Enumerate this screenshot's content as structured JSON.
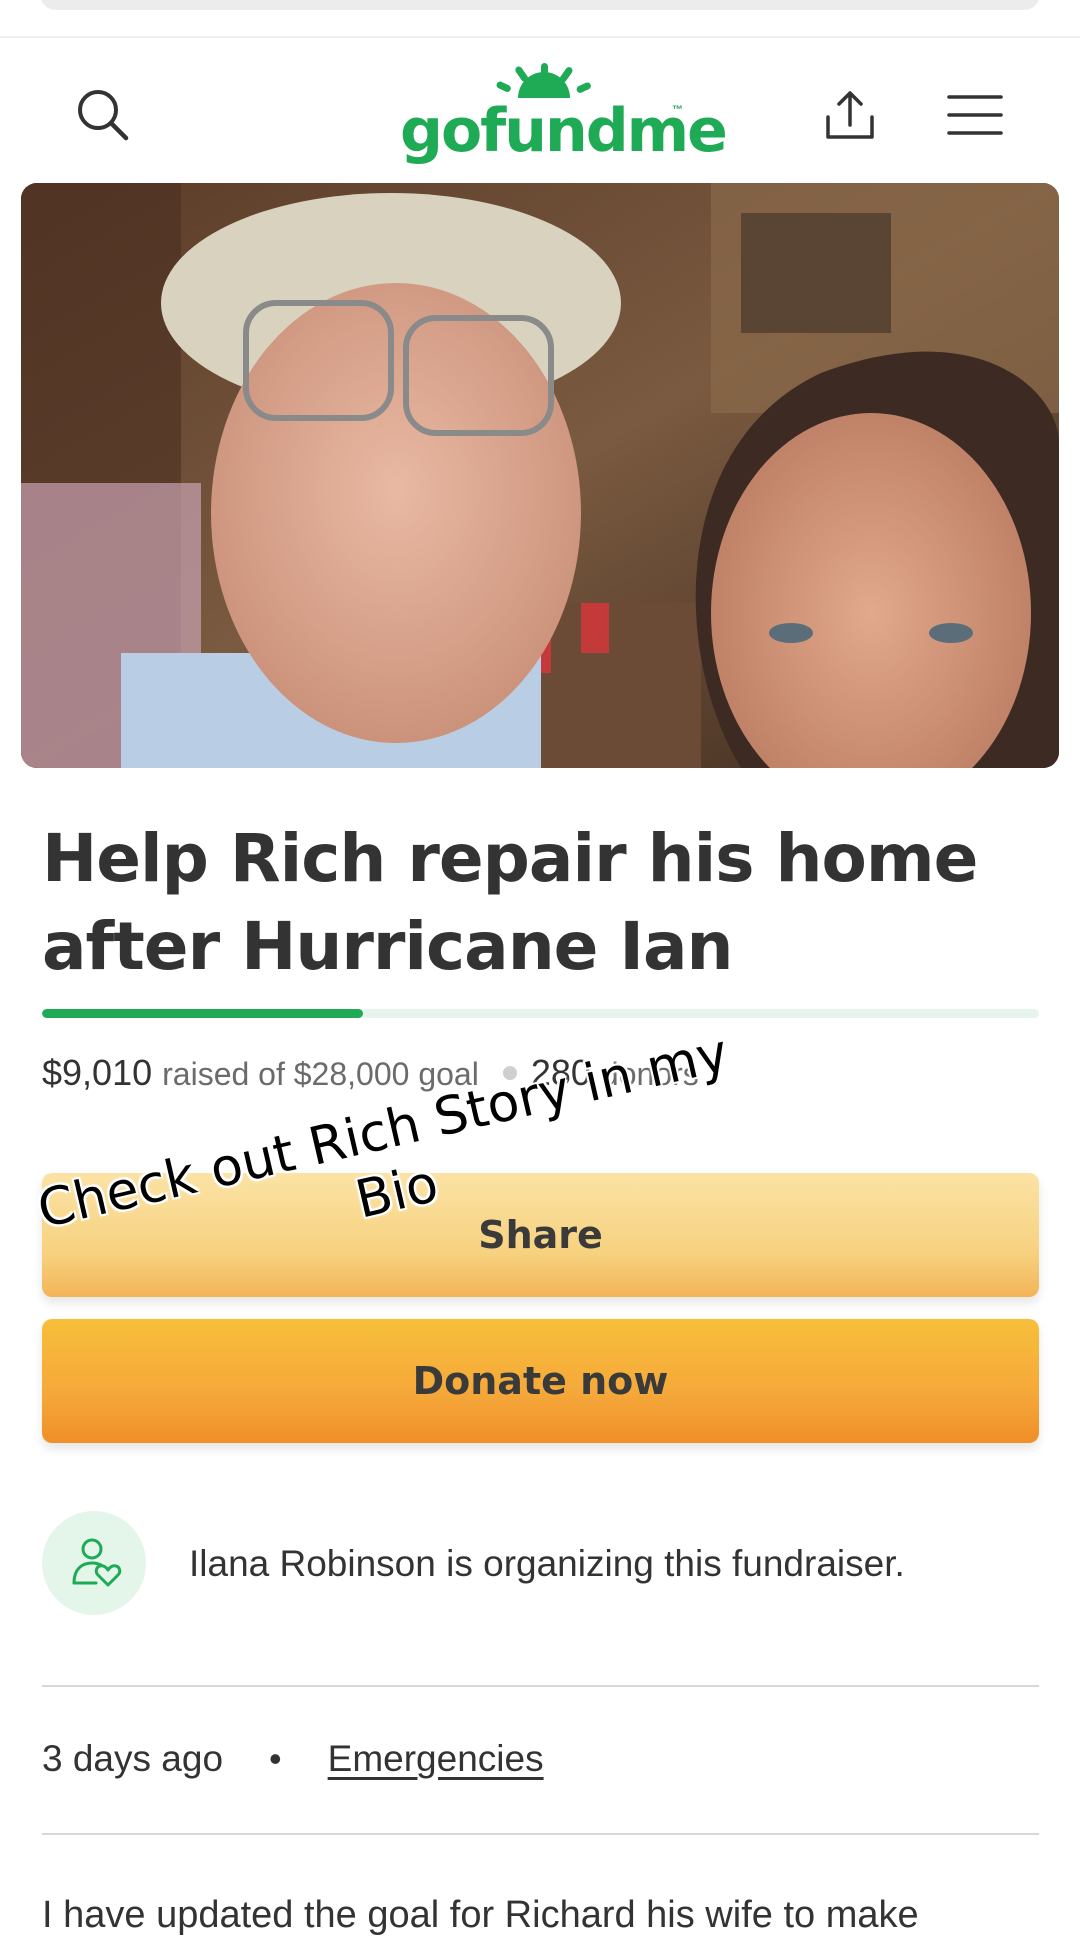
{
  "header": {
    "logo_text": "gofundme",
    "logo_tm": "™",
    "brand_color": "#1faa55"
  },
  "campaign": {
    "title_line1": "Help Rich repair his home",
    "title_line2": "after Hurricane Ian",
    "raised": "$9,010",
    "raised_suffix": "raised of $28,000 goal",
    "donors_count": "280",
    "donors_label": "donors",
    "progress_fraction": 0.322,
    "share_label": "Share",
    "donate_label": "Donate now",
    "organizer_text": "Ilana Robinson is organizing this fundraiser.",
    "posted": "3 days ago",
    "category": "Emergencies",
    "story_preview": "I have updated the goal for Richard his wife to make"
  },
  "overlay": {
    "line1": "Check out Rich Story in my",
    "line2": "Bio"
  },
  "icons": [
    "search-icon",
    "share-upload-icon",
    "menu-icon",
    "organizer-heart-icon"
  ],
  "colors": {
    "progress_fill": "#1faa55",
    "progress_track": "#e6f4ec",
    "share_button": "#f7d17f",
    "donate_button": "#f5a83a"
  }
}
